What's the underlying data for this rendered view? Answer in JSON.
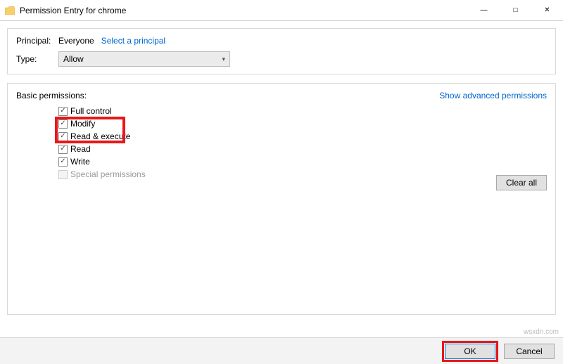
{
  "titlebar": {
    "title": "Permission Entry for chrome"
  },
  "principal": {
    "label": "Principal:",
    "value": "Everyone",
    "select_link": "Select a principal"
  },
  "type": {
    "label": "Type:",
    "value": "Allow"
  },
  "permissions": {
    "header": "Basic permissions:",
    "advanced_link": "Show advanced permissions",
    "items": [
      {
        "label": "Full control",
        "checked": true,
        "enabled": true
      },
      {
        "label": "Modify",
        "checked": true,
        "enabled": true
      },
      {
        "label": "Read & execute",
        "checked": true,
        "enabled": true
      },
      {
        "label": "Read",
        "checked": true,
        "enabled": true
      },
      {
        "label": "Write",
        "checked": true,
        "enabled": true
      },
      {
        "label": "Special permissions",
        "checked": false,
        "enabled": false
      }
    ],
    "clear_all": "Clear all"
  },
  "buttons": {
    "ok": "OK",
    "cancel": "Cancel"
  },
  "watermark": "wsxdn.com"
}
